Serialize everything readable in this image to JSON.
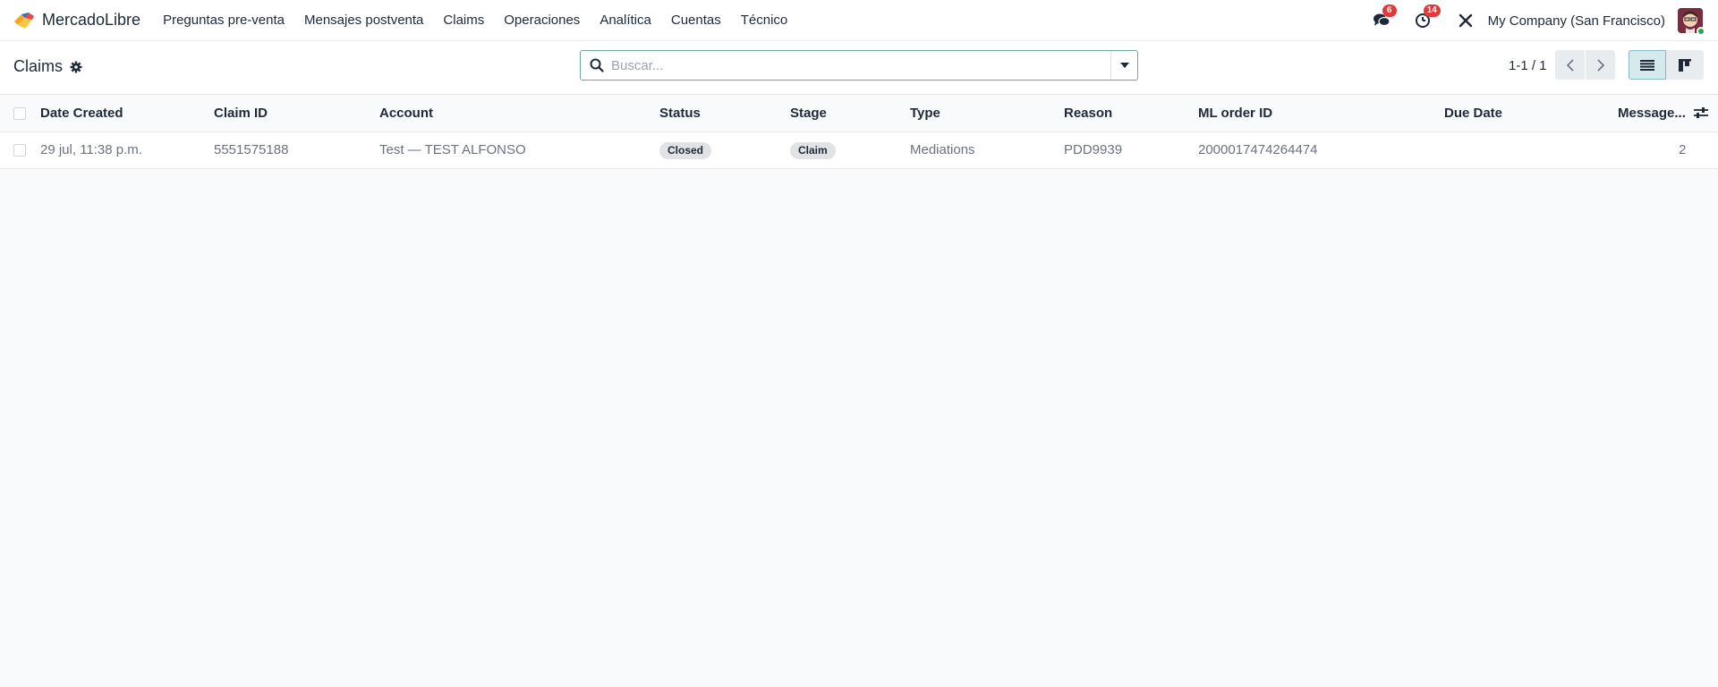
{
  "navbar": {
    "brand": "MercadoLibre",
    "menu": [
      {
        "label": "Preguntas pre-venta"
      },
      {
        "label": "Mensajes postventa"
      },
      {
        "label": "Claims"
      },
      {
        "label": "Operaciones"
      },
      {
        "label": "Analítica"
      },
      {
        "label": "Cuentas"
      },
      {
        "label": "Técnico"
      }
    ],
    "messages_badge": "6",
    "activities_badge": "14",
    "company": "My Company (San Francisco)"
  },
  "control_panel": {
    "title": "Claims",
    "search_placeholder": "Buscar...",
    "pager": "1-1 / 1"
  },
  "table": {
    "headers": {
      "date_created": "Date Created",
      "claim_id": "Claim ID",
      "account": "Account",
      "status": "Status",
      "stage": "Stage",
      "type": "Type",
      "reason": "Reason",
      "ml_order_id": "ML order ID",
      "due_date": "Due Date",
      "messages": "Message..."
    },
    "rows": [
      {
        "date_created": "29 jul, 11:38 p.m.",
        "claim_id": "5551575188",
        "account": "Test — TEST ALFONSO",
        "status": "Closed",
        "stage": "Claim",
        "type": "Mediations",
        "reason": "PDD9939",
        "ml_order_id": "2000017474264474",
        "due_date": "",
        "messages": "2"
      }
    ]
  },
  "icons": {
    "brand": "mercadolibre-logo-icon",
    "messages": "chat-bubbles-icon",
    "activities": "clock-icon",
    "debug": "tools-icon",
    "settings": "gear-icon",
    "search": "search-icon",
    "search_toggle": "caret-down-icon",
    "pager_prev": "chevron-left-icon",
    "pager_next": "chevron-right-icon",
    "list_view": "list-view-icon",
    "kanban_view": "kanban-view-icon",
    "optional_columns": "sliders-icon"
  },
  "colors": {
    "accent": "#71a3a8",
    "badge": "#e0393e",
    "background": "#f9fafb"
  }
}
